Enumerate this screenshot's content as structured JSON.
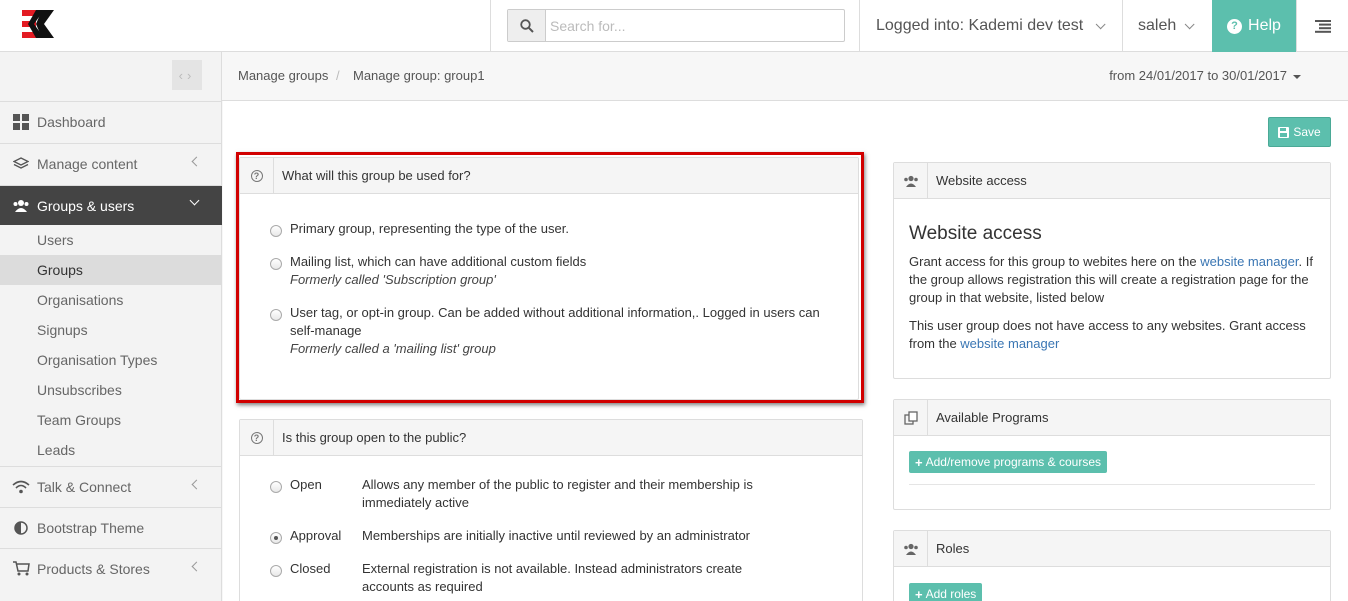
{
  "header": {
    "search_placeholder": "Search for...",
    "logged_into": "Logged into: Kademi dev test",
    "username": "saleh",
    "help_label": "Help"
  },
  "sidebar": {
    "items": [
      {
        "label": "Dashboard",
        "icon": "grid-icon"
      },
      {
        "label": "Manage content",
        "icon": "layers-icon"
      },
      {
        "label": "Groups & users",
        "icon": "users-icon"
      }
    ],
    "subitems": [
      "Users",
      "Groups",
      "Organisations",
      "Signups",
      "Organisation Types",
      "Unsubscribes",
      "Team Groups",
      "Leads"
    ],
    "items_after": [
      {
        "label": "Talk & Connect",
        "icon": "wifi-icon"
      },
      {
        "label": "Bootstrap Theme",
        "icon": "contrast-icon"
      },
      {
        "label": "Products & Stores",
        "icon": "cart-icon"
      }
    ],
    "selected_subitem": "Groups"
  },
  "breadcrumb": {
    "items": [
      "Manage groups",
      "Manage group: group1"
    ],
    "separator": "/",
    "date_range": "from 24/01/2017 to 30/01/2017"
  },
  "save_label": "Save",
  "usage_panel": {
    "title": "What will this group be used for?",
    "options": [
      {
        "label": "Primary group, representing the type of the user.",
        "note": "",
        "checked": false
      },
      {
        "label": "Mailing list, which can have additional custom fields",
        "note": "Formerly called 'Subscription group'",
        "checked": false
      },
      {
        "label": "User tag, or opt-in group. Can be added without additional information,. Logged in users can self-manage",
        "note": "Formerly called a 'mailing list' group",
        "checked": false
      }
    ]
  },
  "public_panel": {
    "title": "Is this group open to the public?",
    "options": [
      {
        "label": "Open",
        "desc": "Allows any member of the public to register and their membership is immediately active",
        "checked": false
      },
      {
        "label": "Approval",
        "desc": "Memberships are initially inactive until reviewed by an administrator",
        "checked": true
      },
      {
        "label": "Closed",
        "desc": "External registration is not available. Instead administrators create accounts as required",
        "checked": false
      }
    ]
  },
  "website_access": {
    "head": "Website access",
    "title": "Website access",
    "p1_before": "Grant access for this group to webites here on the ",
    "p1_link": "website manager",
    "p1_after": ". If the group allows registration this will create a registration page for the group in that website, listed below",
    "p2_before": "This user group does not have access to any websites. Grant access from the ",
    "p2_link": "website manager"
  },
  "programs": {
    "head": "Available Programs",
    "button": "Add/remove programs & courses"
  },
  "roles": {
    "head": "Roles",
    "button": "Add roles"
  },
  "colors": {
    "accent": "#5cbfad",
    "sidebar_active": "#444444",
    "highlight": "#d10000",
    "link": "#3a76b3"
  }
}
